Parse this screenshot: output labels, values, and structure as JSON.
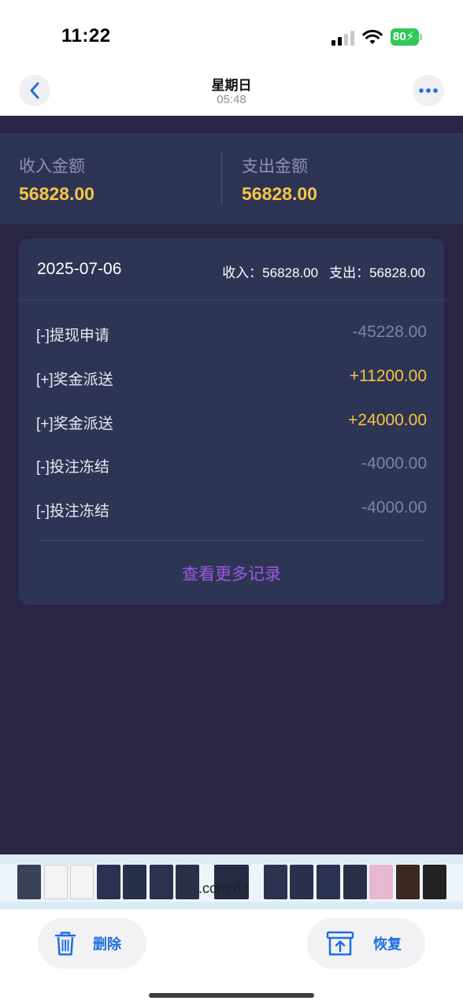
{
  "status_bar": {
    "time": "11:22",
    "battery": "80"
  },
  "nav": {
    "title": "星期日",
    "subtitle": "05:48"
  },
  "summary": {
    "income_label": "收入金额",
    "income_value": "56828.00",
    "expense_label": "支出金额",
    "expense_value": "56828.00"
  },
  "day_card": {
    "date": "2025-07-06",
    "income_total": "收入：56828.00",
    "expense_total": "支出：56828.00",
    "records": [
      {
        "name": "[-]提现申请",
        "amount": "-45228.00",
        "kind": "neg"
      },
      {
        "name": "[+]奖金派送",
        "amount": "+11200.00",
        "kind": "pos"
      },
      {
        "name": "[+]奖金派送",
        "amount": "+24000.00",
        "kind": "pos"
      },
      {
        "name": "[-]投注冻结",
        "amount": "-4000.00",
        "kind": "neg"
      },
      {
        "name": "[-]投注冻结",
        "amount": "-4000.00",
        "kind": "neg"
      }
    ],
    "more_link": "查看更多记录"
  },
  "thumbnail_strip": {
    "overlay_text": ".com    8.t"
  },
  "actions": {
    "delete_label": "删除",
    "restore_label": "恢复"
  },
  "colors": {
    "app_bg": "#282643",
    "panel_bg": "#2d3453",
    "gold": "#f6c445",
    "muted": "#7d849f",
    "link_purple": "#9b59e0",
    "ios_blue": "#1f6fe0"
  },
  "icons": [
    "signal-icon",
    "wifi-icon",
    "battery-icon",
    "back-chevron-icon",
    "more-dots-icon",
    "trash-icon",
    "restore-tray-icon"
  ]
}
